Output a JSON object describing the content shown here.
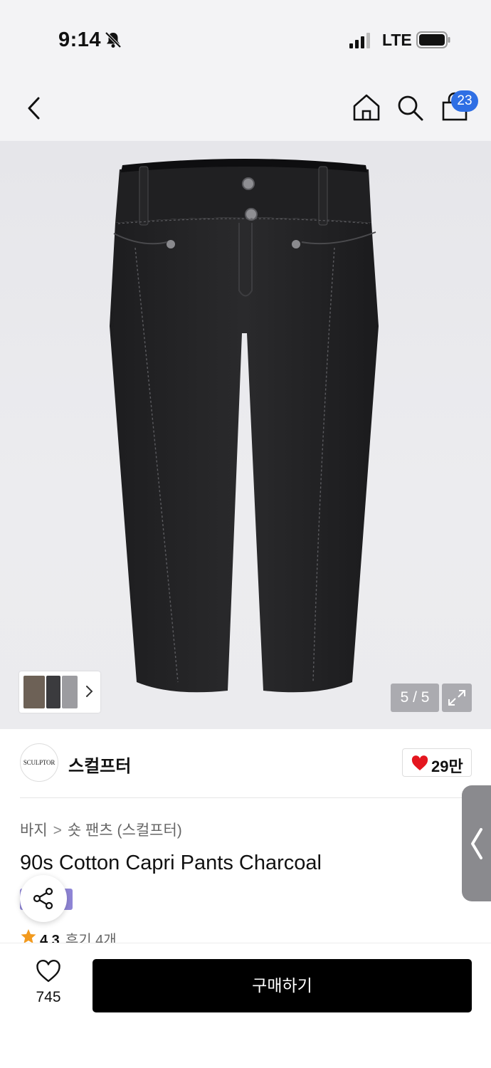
{
  "status_bar": {
    "time": "9:14",
    "network": "LTE"
  },
  "header": {
    "cart_badge": "23",
    "icons": [
      "back-icon",
      "home-icon",
      "search-icon",
      "shopping-bag-icon"
    ]
  },
  "gallery": {
    "counter": "5 / 5",
    "icons": [
      "expand-icon",
      "chevron-right-icon"
    ]
  },
  "brand": {
    "logo_text": "SCULPTOR",
    "name": "스컬프터",
    "likes": "29만"
  },
  "product": {
    "breadcrumb": [
      "바지",
      "숏 팬츠 (스컬프터)"
    ],
    "breadcrumb_separator": ">",
    "title": "90s Cotton Capri Pants Charcoal",
    "rating": "4.3",
    "reviews": "후기 4개"
  },
  "bottom_bar": {
    "wish_count": "745",
    "buy_label": "구매하기"
  },
  "colors": {
    "accent_blue": "#2f6fe4",
    "heart_red": "#e4161f",
    "star_orange": "#f29a1e",
    "tag_purple": "#8f85d6",
    "buy_button": "#000000"
  }
}
